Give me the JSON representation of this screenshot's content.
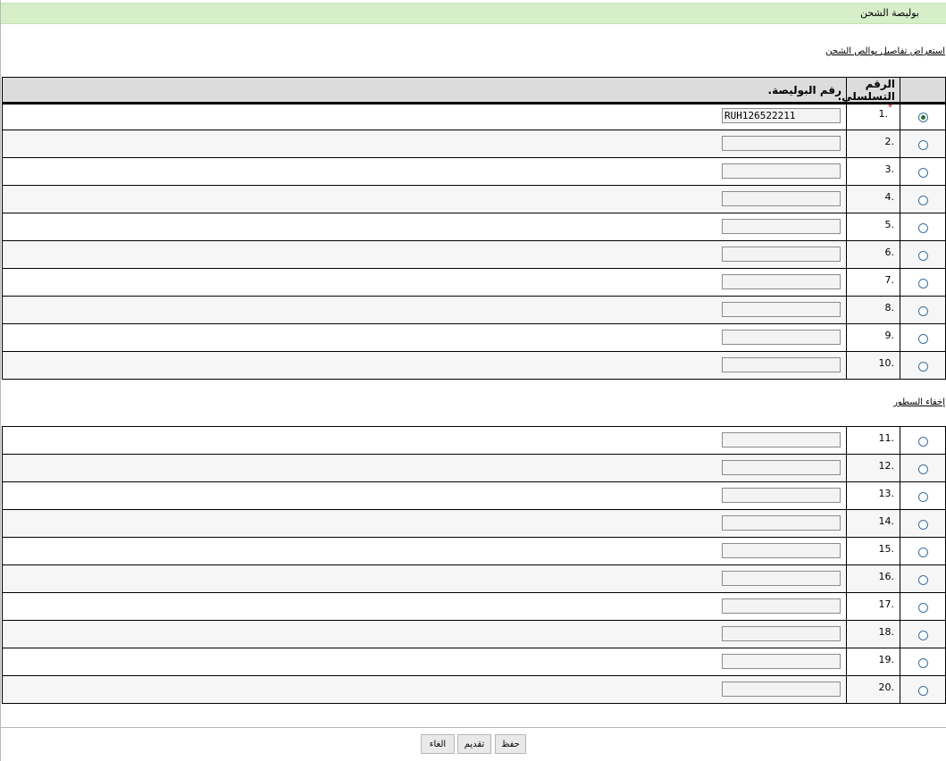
{
  "header": {
    "title": "بوليصة الشحن"
  },
  "links": {
    "show_details": "استعراض تفاصيل بوالص الشحن",
    "hide_rows": "إخفاء السطور"
  },
  "table": {
    "columns": {
      "serial": "الرقم التسلسلي.",
      "policy": "رقم البوليصة."
    },
    "rows": [
      {
        "num": "1.",
        "required": "*",
        "value": "RUH126522211",
        "selected": true
      },
      {
        "num": "2.",
        "value": "",
        "selected": false
      },
      {
        "num": "3.",
        "value": "",
        "selected": false
      },
      {
        "num": "4.",
        "value": "",
        "selected": false
      },
      {
        "num": "5.",
        "value": "",
        "selected": false
      },
      {
        "num": "6.",
        "value": "",
        "selected": false
      },
      {
        "num": "7.",
        "value": "",
        "selected": false
      },
      {
        "num": "8.",
        "value": "",
        "selected": false
      },
      {
        "num": "9.",
        "value": "",
        "selected": false
      },
      {
        "num": "10.",
        "value": "",
        "selected": false
      }
    ],
    "rows_extra": [
      {
        "num": "11.",
        "value": "",
        "selected": false
      },
      {
        "num": "12.",
        "value": "",
        "selected": false
      },
      {
        "num": "13.",
        "value": "",
        "selected": false
      },
      {
        "num": "14.",
        "value": "",
        "selected": false
      },
      {
        "num": "15.",
        "value": "",
        "selected": false
      },
      {
        "num": "16.",
        "value": "",
        "selected": false
      },
      {
        "num": "17.",
        "value": "",
        "selected": false
      },
      {
        "num": "18.",
        "value": "",
        "selected": false
      },
      {
        "num": "19.",
        "value": "",
        "selected": false
      },
      {
        "num": "20.",
        "value": "",
        "selected": false
      }
    ]
  },
  "buttons": {
    "save": "حفظ",
    "submit": "تقديم",
    "cancel": "الغاء"
  }
}
